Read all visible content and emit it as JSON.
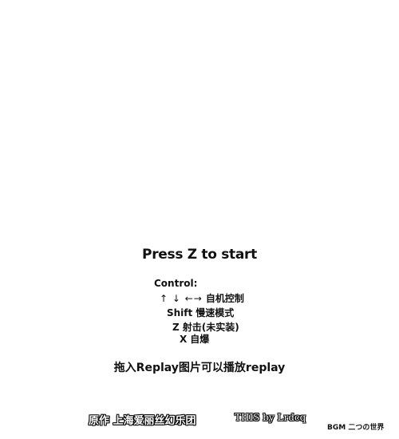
{
  "title_screen": {
    "prompt": "Press Z to start"
  },
  "controls": {
    "heading": "Control:",
    "move_keys": "↑ ↓ ←→",
    "move_desc": "自机控制",
    "shift_key": "Shift",
    "shift_desc": "慢速模式",
    "z_key": "Z",
    "z_desc": "射击(未实装)",
    "x_key": "X",
    "x_desc": "自爆"
  },
  "replay": {
    "hint": "拖入Replay图片可以播放replay"
  },
  "credits": {
    "original": "原作 上海爱丽丝幻乐团",
    "author": "THIS by Lrdcq",
    "bgm": "BGM 二つの世界"
  }
}
